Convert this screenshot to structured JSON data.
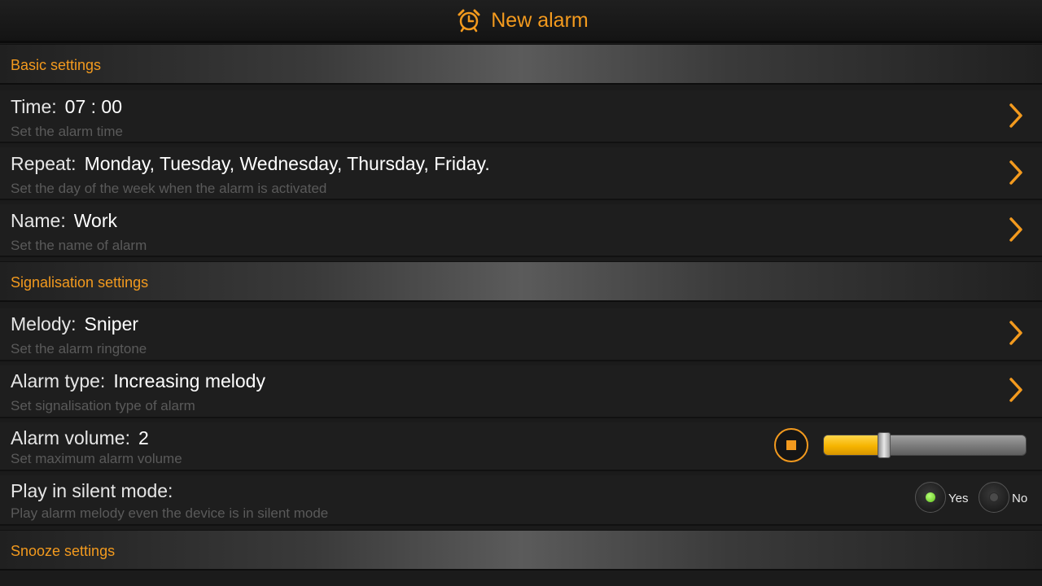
{
  "header": {
    "title": "New alarm",
    "icon": "alarm-clock-icon",
    "accent": "#f39a1e"
  },
  "sections": {
    "basic": "Basic settings",
    "signalisation": "Signalisation settings",
    "snooze": "Snooze settings"
  },
  "rows": {
    "time": {
      "label": "Time:",
      "value": "07 : 00",
      "sub": "Set the alarm time"
    },
    "repeat": {
      "label": "Repeat:",
      "value": "Monday, Tuesday, Wednesday, Thursday, Friday.",
      "sub": "Set the day of the week when the alarm is activated"
    },
    "name": {
      "label": "Name:",
      "value": "Work",
      "sub": "Set the name of alarm"
    },
    "melody": {
      "label": "Melody:",
      "value": "Sniper",
      "sub": "Set the alarm ringtone"
    },
    "alarm_type": {
      "label": "Alarm type:",
      "value": "Increasing melody",
      "sub": "Set signalisation type of alarm"
    },
    "volume": {
      "label": "Alarm volume:",
      "value": "2",
      "sub": "Set maximum alarm volume",
      "slider_fraction": 0.3,
      "fill_color": "#f6b400"
    },
    "silent": {
      "label": "Play in silent mode:",
      "sub": "Play alarm melody even the device is in silent mode",
      "yes": "Yes",
      "no": "No",
      "selected": "Yes"
    }
  }
}
